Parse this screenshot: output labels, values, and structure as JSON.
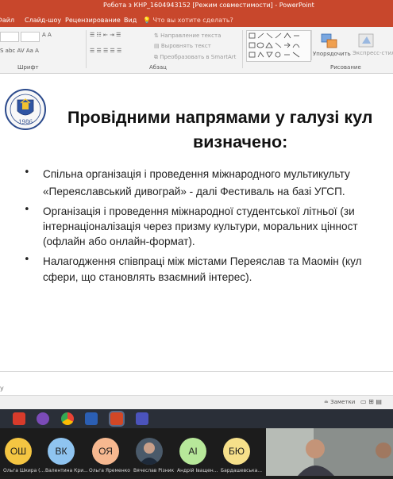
{
  "window": {
    "title": "Робота з КНР_1604943152 [Режим совместимости] - PowerPoint"
  },
  "tabs": [
    "Файл",
    "Слайд-шоу",
    "Рецензирование",
    "Вид"
  ],
  "tell_me": "Что вы хотите сделать?",
  "ribbon": {
    "text_direction": "Направление текста",
    "align_text": "Выровнять текст",
    "smartart": "Преобразовать в SmartArt",
    "arrange": "Упорядочить",
    "express_styles": "Экспресс-стили",
    "group_font": "Шрифт",
    "group_paragraph": "Абзац",
    "group_drawing": "Рисование"
  },
  "slide": {
    "title_line1": "Провідними напрямами у галузі кул",
    "title_line2": "визначено:",
    "logo_year": "1986",
    "bullets": [
      [
        "Спільна організація і проведення міжнародного мультикульту",
        "«Переяславський дивограй» - далі Фестиваль на базі УГСП."
      ],
      [
        "Організація і проведення міжнародної студентської літньої (зи",
        "інтернаціоналізація через призму культури, моральних цінност",
        "(офлайн або онлайн-формат)."
      ],
      [
        "Налагодження співпраці між містами Переяслав та Маомін (кул",
        "сфери, що становлять взаємний інтерес)."
      ]
    ]
  },
  "notes": {
    "placeholder": "Заметки",
    "left_text": "у"
  },
  "participants": [
    {
      "initials": "ОШ",
      "name": "Ольга Шкира (...",
      "color": "#f4c542"
    },
    {
      "initials": "ВК",
      "name": "Валентина Кри...",
      "color": "#8fc4f0"
    },
    {
      "initials": "ОЯ",
      "name": "Ольга Яременко",
      "color": "#f6b890"
    },
    {
      "initials": "",
      "name": "Вячеслав Різник",
      "color": "#4a5a6a"
    },
    {
      "initials": "АІ",
      "name": "Андрій Іващен...",
      "color": "#b7e89a"
    },
    {
      "initials": "БЮ",
      "name": "Бардашевська...",
      "color": "#f6e08a"
    }
  ]
}
